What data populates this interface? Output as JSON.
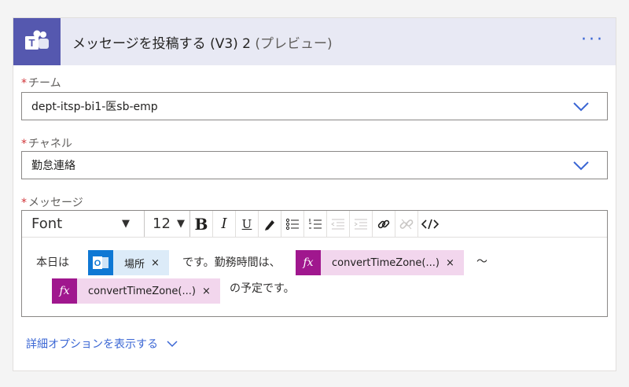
{
  "action": {
    "title": "メッセージを投稿する (V3) 2",
    "suffix": "(プレビュー)",
    "menu": "···",
    "colors": {
      "header_bg": "#e8e9f4",
      "teams": "#5558af",
      "accent": "#3a66d4"
    }
  },
  "fields": {
    "team": {
      "label": "チーム",
      "required_mark": "*",
      "value": "dept-itsp-bi1-医sb-emp"
    },
    "channel": {
      "label": "チャネル",
      "required_mark": "*",
      "value": "勤怠連絡"
    },
    "message": {
      "label": "メッセージ",
      "required_mark": "*"
    }
  },
  "toolbar": {
    "font": "Font",
    "size": "12",
    "bold": "B",
    "italic": "I",
    "underline": "U",
    "caret": "▼"
  },
  "editor": {
    "text_start": "本日は",
    "token_location": {
      "label": "場所",
      "remove": "×"
    },
    "text_mid": "です。勤務時間は、",
    "token_expr1": {
      "icon": "fx",
      "label": "convertTimeZone(...)",
      "remove": "×"
    },
    "text_tilde": "〜",
    "token_expr2": {
      "icon": "fx",
      "label": "convertTimeZone(...)",
      "remove": "×"
    },
    "text_end": "の予定です。"
  },
  "advanced": {
    "label": "詳細オプションを表示する"
  }
}
